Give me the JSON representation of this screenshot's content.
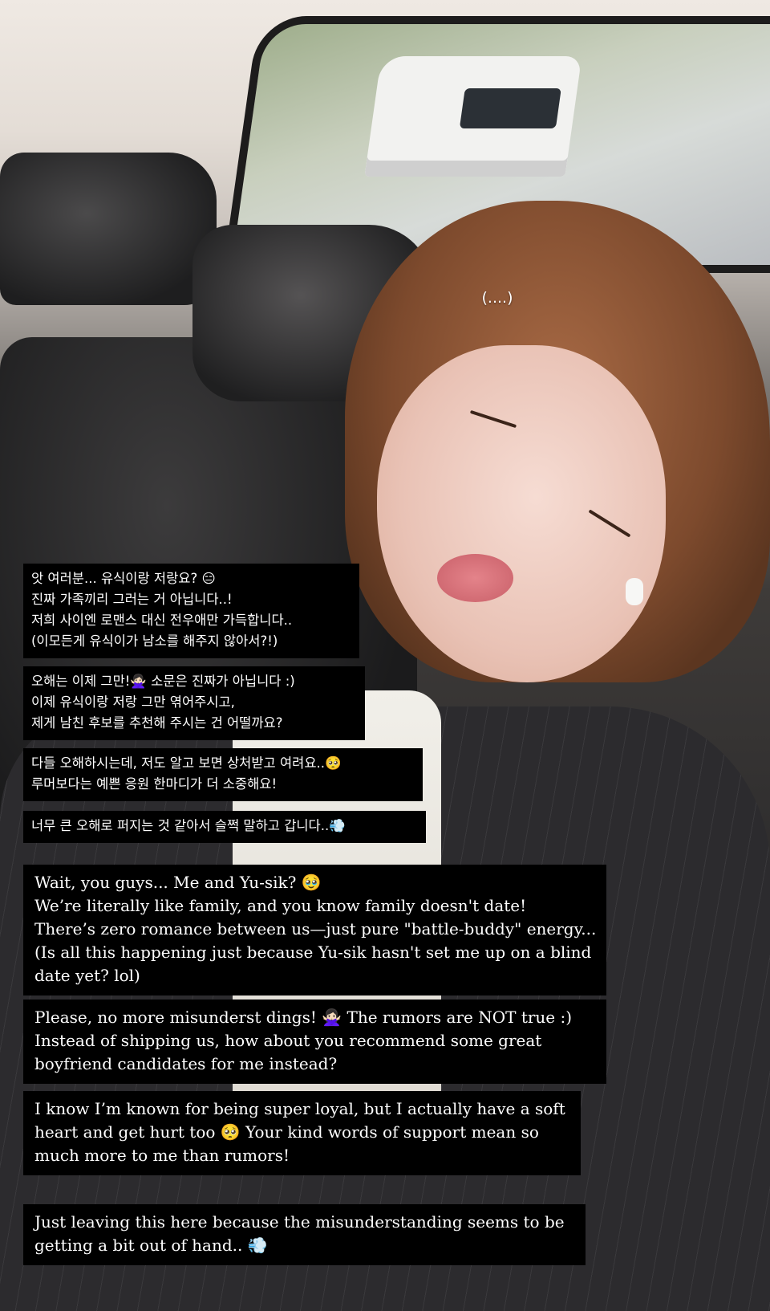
{
  "photo_overlay": {
    "ellipsis": "(....)"
  },
  "captions_korean": [
    {
      "lines": [
        "앗 여러분... 유식이랑 저랑요? 😑",
        "진짜 가족끼리 그러는 거 아닙니다..!",
        "저희 사이엔 로맨스 대신 전우애만 가득합니다..",
        "(이모든게 유식이가 남소를 해주지 않아서?!)"
      ]
    },
    {
      "lines": [
        "오해는 이제 그만!🙅🏻‍♀️ 소문은 진짜가 아닙니다 :)",
        "이제 유식이랑 저랑 그만 엮어주시고,",
        "제게 남친 후보를 추천해 주시는 건 어떨까요?"
      ]
    },
    {
      "lines": [
        "다들 오해하시는데, 저도 알고 보면 상처받고 여려요..🥺",
        "루머보다는 예쁜 응원 한마디가 더 소중해요!"
      ]
    },
    {
      "lines": [
        "너무 큰 오해로 퍼지는 것 같아서 슬쩍 말하고 갑니다..💨"
      ]
    }
  ],
  "captions_english": [
    {
      "lines": [
        "Wait, you guys... Me and Yu-sik? 🥹",
        "We’re literally like family, and you know family doesn't date!",
        "There’s zero romance between us—just pure \"battle-buddy\" energy...",
        "(Is all this happening just because Yu-sik hasn't set me up on a blind",
        "date yet? lol)"
      ]
    },
    {
      "lines": [
        "Please, no more misunderst   dings! 🙅🏻‍♀️ The rumors are NOT true :)",
        "Instead of shipping us, how about you recommend some great",
        "boyfriend candidates for me instead?"
      ]
    },
    {
      "lines": [
        "I know I’m known for being super loyal, but I actually have a soft",
        "heart and get hurt too 🥺 Your kind words of support mean so",
        "much more to me than rumors!"
      ]
    },
    {
      "lines": [
        "Just leaving this here because the misunderstanding seems to be",
        "getting a bit out of hand.. 💨"
      ]
    }
  ]
}
